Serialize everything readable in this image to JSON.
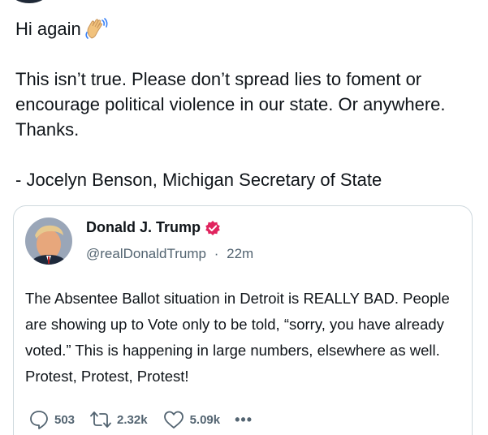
{
  "tweet": {
    "greeting": "Hi again",
    "greeting_emoji_icon": "waving-hand-icon",
    "body": "This isn’t true. Please don’t spread lies to foment or encourage political violence in our state. Or anywhere. Thanks.",
    "signature": "- Jocelyn Benson, Michigan Secretary of State"
  },
  "quoted": {
    "name": "Donald J. Trump",
    "verified_icon": "verified-badge-icon",
    "handle": "@realDonaldTrump",
    "separator": "·",
    "time": "22m",
    "text": "The Absentee Ballot situation in Detroit is REALLY BAD. People are showing up to Vote only to be told, “sorry, you have already voted.” This is happening in large numbers, elsewhere as well. Protest, Protest, Protest!",
    "actions": {
      "replies": "503",
      "retweets": "2.32k",
      "likes": "5.09k",
      "more": "•••"
    }
  },
  "colors": {
    "text": "#0f1419",
    "secondary": "#536471",
    "border": "#cfd9de",
    "verified": "#e0245e"
  }
}
